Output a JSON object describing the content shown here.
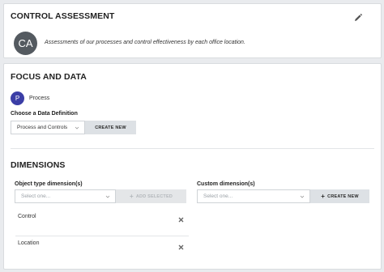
{
  "assessment": {
    "title": "CONTROL ASSESSMENT",
    "avatar_initials": "CA",
    "description": "Assessments of our processes and control effectiveness by each office location."
  },
  "focus": {
    "title": "FOCUS AND DATA",
    "process_initial": "P",
    "process_label": "Process",
    "definition_label": "Choose a Data Definition",
    "definition_value": "Process and Controls",
    "create_new_label": "CREATE NEW"
  },
  "dimensions": {
    "title": "DIMENSIONS",
    "object_type_label": "Object type dimension(s)",
    "object_type_placeholder": "Select one...",
    "add_selected_label": "ADD SELECTED",
    "custom_label": "Custom dimension(s)",
    "custom_placeholder": "Select one...",
    "custom_create_label": "CREATE NEW",
    "items": [
      {
        "label": "Control"
      },
      {
        "label": "Location"
      }
    ]
  },
  "colors": {
    "avatar_ca": "#545a60",
    "avatar_p": "#3b3ea6",
    "button_bg": "#dde1e5"
  }
}
